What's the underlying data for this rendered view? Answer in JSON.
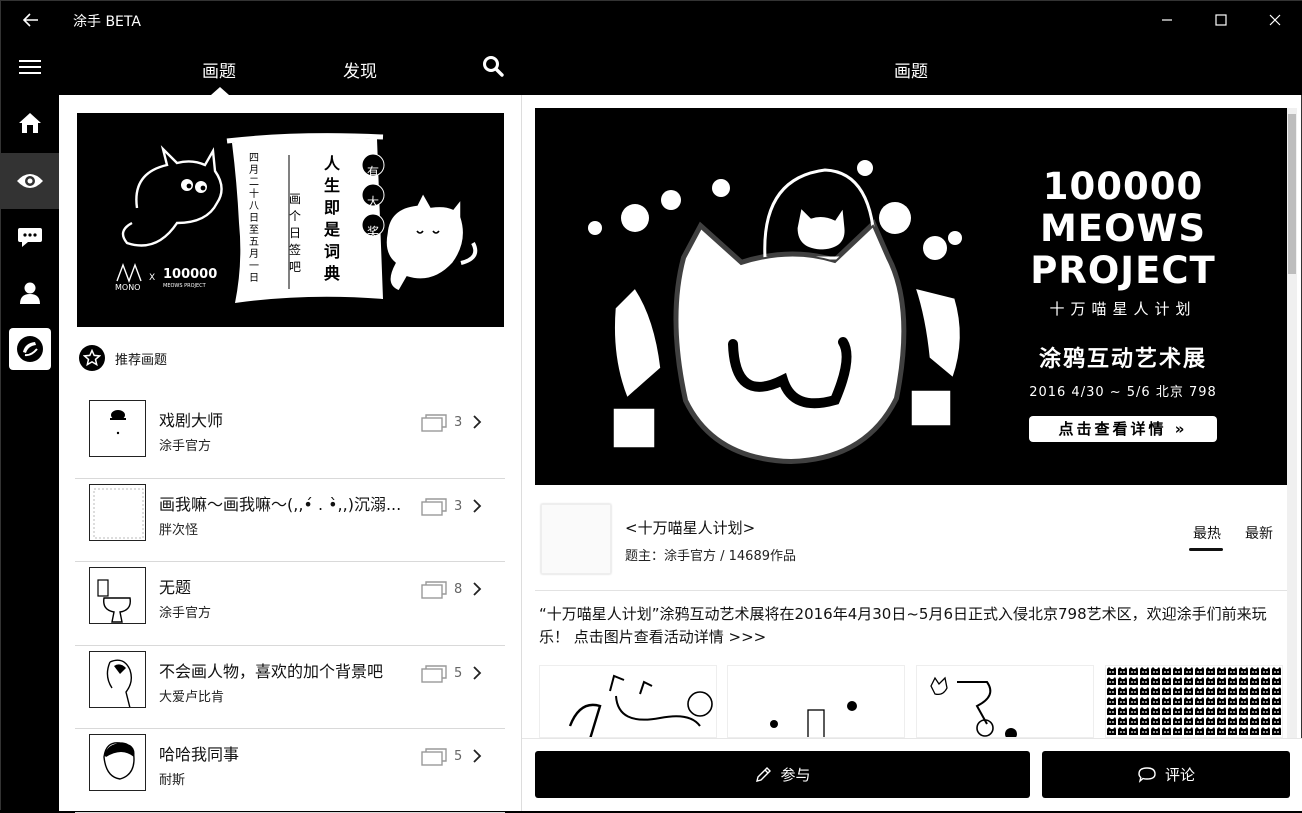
{
  "app": {
    "title": "涂手 BETA"
  },
  "nav": {
    "tabs": [
      {
        "label": "画题"
      },
      {
        "label": "发现"
      }
    ],
    "right_title": "画题"
  },
  "left": {
    "banner": {
      "scroll_text": "人生即是词典",
      "side_text": "四月二十八日 至 五月一日",
      "small_text": "画个日签吧",
      "badge": "有大奖",
      "logo_left": "MONO",
      "logo_x": "X",
      "logo_right": "100000",
      "logo_right_sub": "MEOWS PROJECT"
    },
    "recommended_label": "推荐画题",
    "topics": [
      {
        "title": "戏剧大师",
        "author": "涂手官方",
        "count": "3"
      },
      {
        "title": "画我嘛～画我嘛～(,,•́ . •̀,,)沉溺...",
        "author": "胖次怪",
        "count": "3"
      },
      {
        "title": "无题",
        "author": "涂手官方",
        "count": "8"
      },
      {
        "title": "不会画人物，喜欢的加个背景吧",
        "author": "大爱卢比肯",
        "count": "5"
      },
      {
        "title": "哈哈我同事",
        "author": "耐斯",
        "count": "5"
      }
    ]
  },
  "right": {
    "banner": {
      "line1": "100000",
      "line2": "MEOWS",
      "line3": "PROJECT",
      "sub": "十万喵星人计划",
      "exhibit": "涂鸦互动艺术展",
      "date": "2016  4/30 ~ 5/6  北京  798",
      "cta": "点击查看详情 »"
    },
    "topic_title": "<十万喵星人计划>",
    "topic_meta": "题主：涂手官方 / 14689作品",
    "sort": {
      "hot": "最热",
      "new": "最新"
    },
    "description": "“十万喵星人计划”涂鸦互动艺术展将在2016年4月30日~5月6日正式入侵北京798艺术区，欢迎涂手们前来玩乐！ 点击图片查看活动详情 >>>",
    "buttons": {
      "join": "参与",
      "comment": "评论"
    }
  },
  "colors": {
    "background": "#000000",
    "panel": "#ffffff",
    "accent": "#000000"
  }
}
